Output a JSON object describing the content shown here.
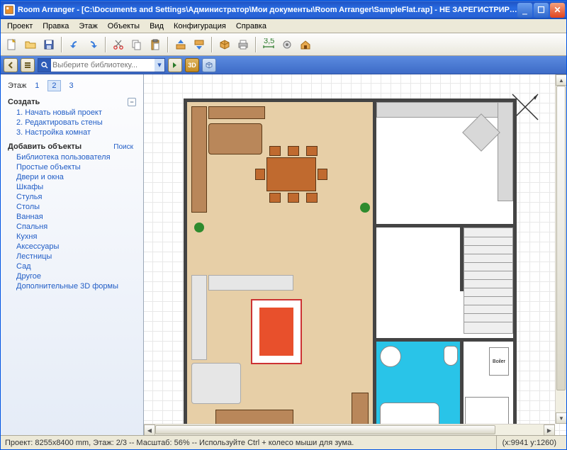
{
  "title": "Room Arranger - [C:\\Documents and Settings\\Администратор\\Мои документы\\Room Arranger\\SampleFlat.rap] - НЕ ЗАРЕГИСТРИРО...",
  "menu": [
    "Проект",
    "Правка",
    "Этаж",
    "Объекты",
    "Вид",
    "Конфигурация",
    "Справка"
  ],
  "search_placeholder": "Выберите библиотеку...",
  "threeD": "3D",
  "sidebar": {
    "floor_label": "Этаж",
    "floors": [
      "1",
      "2",
      "3"
    ],
    "floor_selected": 1,
    "create_heading": "Создать",
    "create_items": [
      "1. Начать новый проект",
      "2. Редактировать стены",
      "3. Настройка комнат"
    ],
    "add_heading": "Добавить объекты",
    "search_link": "Поиск",
    "categories": [
      "Библиотека пользователя",
      "Простые объекты",
      "Двери и окна",
      "Шкафы",
      "Стулья",
      "Столы",
      "Ванная",
      "Спальня",
      "Кухня",
      "Аксессуары",
      "Лестницы",
      "Сад",
      "Другое",
      "Дополнительные 3D формы"
    ]
  },
  "boiler_label": "Boiler",
  "status": {
    "left": "Проект: 8255x8400 mm,  Этаж: 2/3  --  Масштаб: 56%  --  Используйте Ctrl + колесо мыши для зума.",
    "coords": "(x:9941 y:1260)"
  }
}
